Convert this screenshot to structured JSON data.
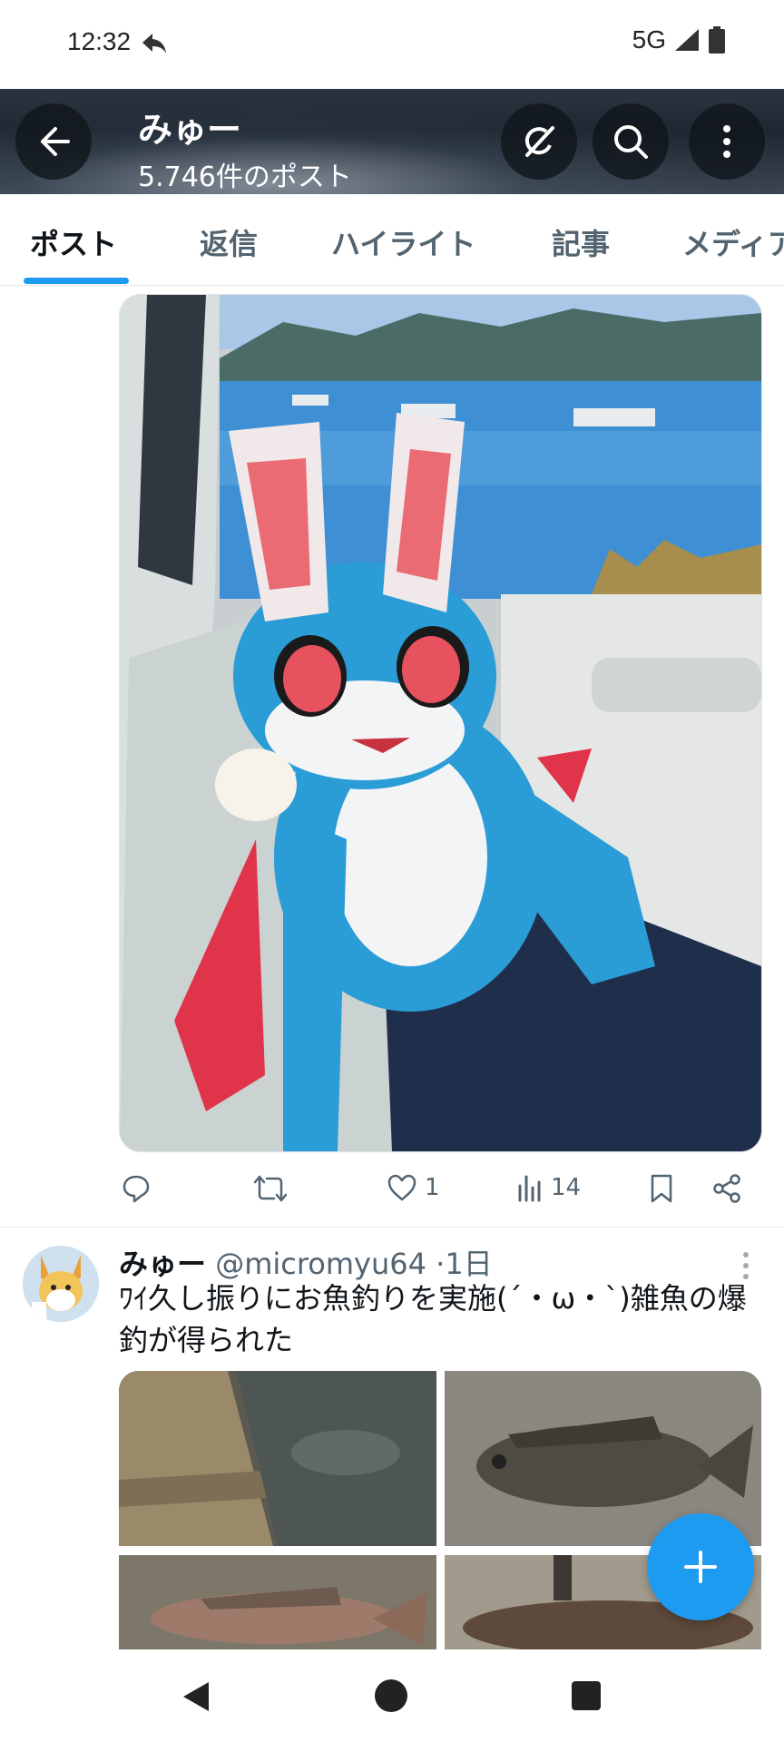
{
  "status_bar": {
    "time": "12:32",
    "network": "5G",
    "icons": [
      "reply-arrow-icon",
      "signal-icon",
      "battery-icon"
    ]
  },
  "profile_header": {
    "name": "みゅー",
    "post_count": "5.746件のポスト",
    "buttons": [
      "back-arrow-icon",
      "grok-icon",
      "search-icon",
      "more-vertical-icon"
    ]
  },
  "tabs": [
    {
      "label": "ポスト",
      "active": true
    },
    {
      "label": "返信",
      "active": false
    },
    {
      "label": "ハイライト",
      "active": false
    },
    {
      "label": "記事",
      "active": false
    },
    {
      "label": "メディア",
      "active": false
    }
  ],
  "post1": {
    "media": "photo of a blue bat plush sitting in a car seat by a harbor",
    "actions": {
      "reply_count": "",
      "repost_count": "",
      "like_count": "1",
      "views_count": "14"
    }
  },
  "post2": {
    "name": "みゅー",
    "handle": "@micromyu64",
    "time": "·1日",
    "text": "ﾜｲ久し振りにお魚釣りを実施(´・ω・`)雑魚の爆釣が得られた"
  },
  "colors": {
    "accent": "#1d9bf0",
    "text_primary": "#0f1419",
    "text_secondary": "#536471"
  }
}
